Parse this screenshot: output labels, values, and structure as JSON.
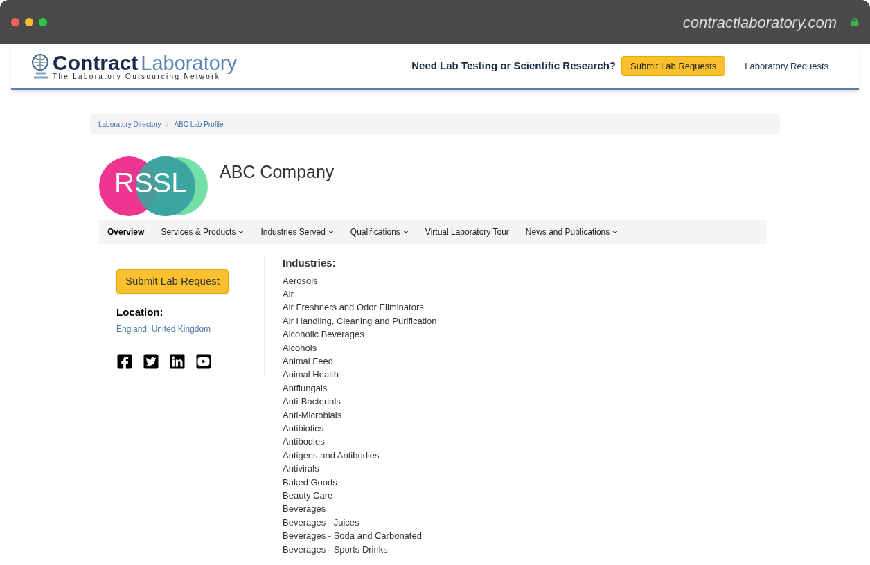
{
  "browser": {
    "url": "contractlaboratory.com"
  },
  "header": {
    "brand_bold": "Contract",
    "brand_light": "Laboratory",
    "tagline": "The Laboratory Outsourcing Network",
    "prompt": "Need Lab Testing or Scientific Research?",
    "cta": "Submit Lab Requests",
    "link": "Laboratory Requests"
  },
  "breadcrumbs": [
    "Laboratory Directory",
    "ABC Lab Profile"
  ],
  "breadcrumb_separator": "/",
  "company": {
    "logo_text": "RSSL",
    "name": "ABC Company"
  },
  "tabs": [
    {
      "label": "Overview",
      "selected": true,
      "dropdown": false
    },
    {
      "label": "Services & Products",
      "selected": false,
      "dropdown": true
    },
    {
      "label": "Industries Served",
      "selected": false,
      "dropdown": true
    },
    {
      "label": "Qualifications",
      "selected": false,
      "dropdown": true
    },
    {
      "label": "Virtual Laboratory Tour",
      "selected": false,
      "dropdown": false
    },
    {
      "label": "News and Publications",
      "selected": false,
      "dropdown": true
    }
  ],
  "sidebar": {
    "button": "Submit Lab Request",
    "location_label": "Location:",
    "location": "England, United Kingdom",
    "social": [
      {
        "kind": "facebook"
      },
      {
        "kind": "twitter"
      },
      {
        "kind": "linkedin"
      },
      {
        "kind": "youtube"
      }
    ]
  },
  "industries": {
    "title": "Industries:",
    "items": [
      "Aerosols",
      "Air",
      "Air Freshners and Odor Eliminators",
      "Air Handling, Cleaning and Purification",
      "Alcoholic Beverages",
      "Alcohols",
      "Animal Feed",
      "Animal Health",
      "Antfiungals",
      "Anti-Bacterials",
      "Anti-Microbials",
      "Antibiotics",
      "Antibodies",
      "Antigens and Antibodies",
      "Antivirals",
      "Baked Goods",
      "Beauty Care",
      "Beverages",
      "Beverages - Juices",
      "Beverages - Soda and Carbonated",
      "Beverages - Sports Drinks"
    ]
  }
}
